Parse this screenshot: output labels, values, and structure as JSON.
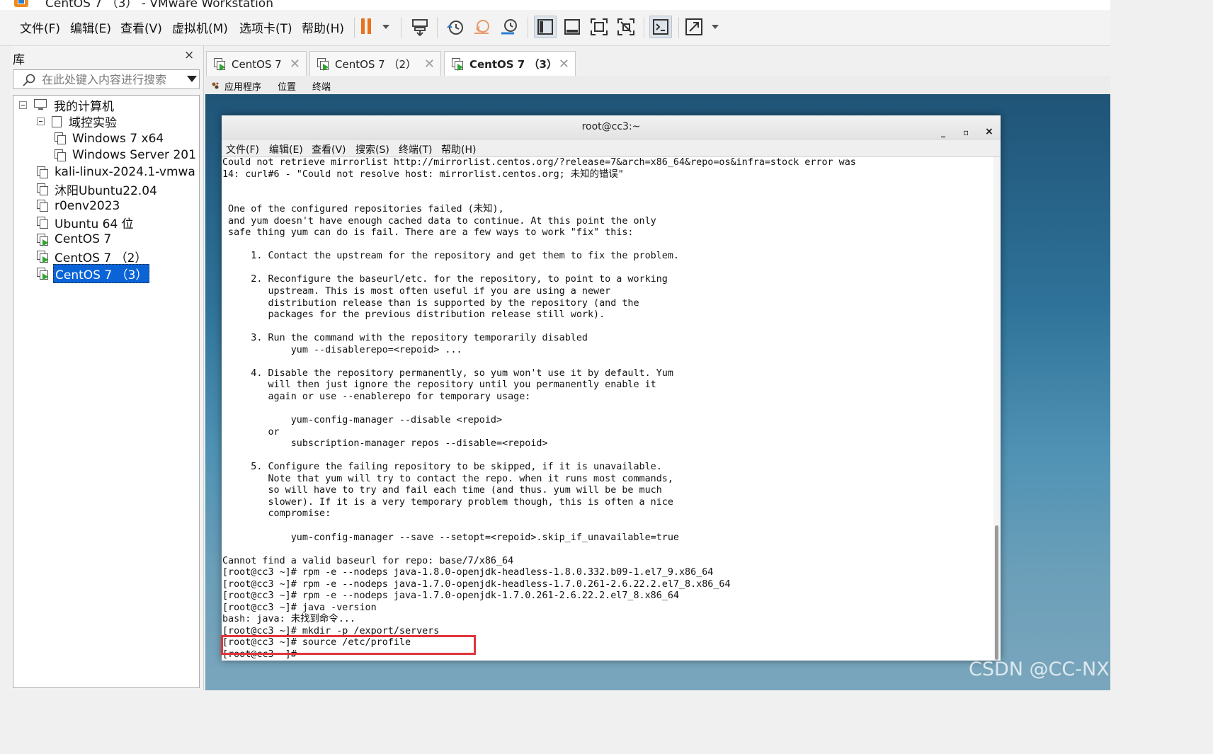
{
  "window": {
    "title": "CentOS 7 （3） - VMware Workstation"
  },
  "menubar": {
    "items": [
      "文件(F)",
      "编辑(E)",
      "查看(V)",
      "虚拟机(M)",
      "选项卡(T)",
      "帮助(H)"
    ]
  },
  "toolbar": {
    "buttons": [
      "pause-icon",
      "send-ctrl-alt-del-icon",
      "snapshot-icon",
      "revert-snapshot-icon",
      "snapshot-manager-icon",
      "show-library-icon",
      "thumbnail-bar-icon",
      "fullscreen-icon",
      "unity-icon",
      "console-view-icon",
      "stretch-icon"
    ]
  },
  "library": {
    "title": "库",
    "close": "×",
    "search_placeholder": "在此处键入内容进行搜索",
    "tree": [
      {
        "label": "我的计算机",
        "type": "computer"
      },
      {
        "label": "域控实验",
        "type": "folder"
      },
      {
        "label": "Windows 7 x64",
        "type": "vm"
      },
      {
        "label": "Windows Server 201",
        "type": "vm"
      },
      {
        "label": "kali-linux-2024.1-vmwa",
        "type": "vm"
      },
      {
        "label": "沐阳Ubuntu22.04",
        "type": "vm"
      },
      {
        "label": "r0env2023",
        "type": "vm"
      },
      {
        "label": "Ubuntu 64 位",
        "type": "vm"
      },
      {
        "label": "CentOS 7",
        "type": "vm-running"
      },
      {
        "label": "CentOS 7 （2）",
        "type": "vm-running"
      },
      {
        "label": "CentOS 7 （3）",
        "type": "vm-running",
        "selected": true
      }
    ]
  },
  "tabs": [
    {
      "label": "CentOS 7",
      "active": false
    },
    {
      "label": "CentOS 7 （2）",
      "active": false
    },
    {
      "label": "CentOS 7 （3）",
      "active": true
    }
  ],
  "guest": {
    "topbar": [
      "应用程序",
      "位置",
      "终端"
    ],
    "terminal": {
      "title": "root@cc3:~",
      "controls": [
        "_",
        "▫",
        "×"
      ],
      "menu": [
        "文件(F)",
        "编辑(E)",
        "查看(V)",
        "搜索(S)",
        "终端(T)",
        "帮助(H)"
      ],
      "lines": [
        "Could not retrieve mirrorlist http://mirrorlist.centos.org/?release=7&arch=x86_64&repo=os&infra=stock error was",
        "14: curl#6 - \"Could not resolve host: mirrorlist.centos.org; 未知的错误\"",
        "",
        "",
        " One of the configured repositories failed (未知),",
        " and yum doesn't have enough cached data to continue. At this point the only",
        " safe thing yum can do is fail. There are a few ways to work \"fix\" this:",
        "",
        "     1. Contact the upstream for the repository and get them to fix the problem.",
        "",
        "     2. Reconfigure the baseurl/etc. for the repository, to point to a working",
        "        upstream. This is most often useful if you are using a newer",
        "        distribution release than is supported by the repository (and the",
        "        packages for the previous distribution release still work).",
        "",
        "     3. Run the command with the repository temporarily disabled",
        "            yum --disablerepo=<repoid> ...",
        "",
        "     4. Disable the repository permanently, so yum won't use it by default. Yum",
        "        will then just ignore the repository until you permanently enable it",
        "        again or use --enablerepo for temporary usage:",
        "",
        "            yum-config-manager --disable <repoid>",
        "        or",
        "            subscription-manager repos --disable=<repoid>",
        "",
        "     5. Configure the failing repository to be skipped, if it is unavailable.",
        "        Note that yum will try to contact the repo. when it runs most commands,",
        "        so will have to try and fail each time (and thus. yum will be be much",
        "        slower). If it is a very temporary problem though, this is often a nice",
        "        compromise:",
        "",
        "            yum-config-manager --save --setopt=<repoid>.skip_if_unavailable=true",
        "",
        "Cannot find a valid baseurl for repo: base/7/x86_64",
        "[root@cc3 ~]# rpm -e --nodeps java-1.8.0-openjdk-headless-1.8.0.332.b09-1.el7_9.x86_64",
        "[root@cc3 ~]# rpm -e --nodeps java-1.7.0-openjdk-headless-1.7.0.261-2.6.22.2.el7_8.x86_64",
        "[root@cc3 ~]# rpm -e --nodeps java-1.7.0-openjdk-1.7.0.261-2.6.22.2.el7_8.x86_64",
        "[root@cc3 ~]# java -version",
        "bash: java: 未找到命令...",
        "[root@cc3 ~]# mkdir -p /export/servers",
        "[root@cc3 ~]# source /etc/profile",
        "[root@cc3 ~]#"
      ]
    }
  },
  "watermark": "CSDN @CC-NX",
  "colors": {
    "selection": "#0a64d8",
    "highlight_box": "#e0353c",
    "pause": "#e8731c",
    "running": "#2fa52f"
  }
}
